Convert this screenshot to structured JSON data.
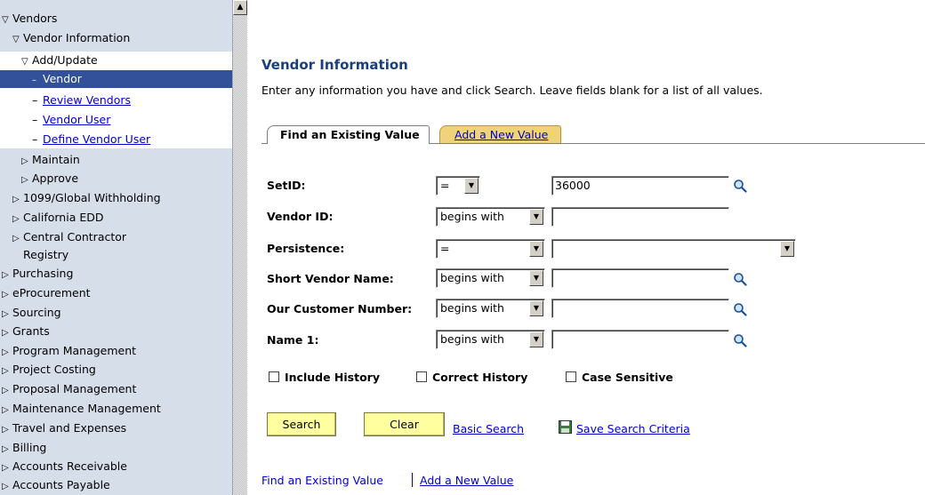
{
  "menu": {
    "items": [
      {
        "label": "Vendors",
        "marker": "▽",
        "indent": 0
      },
      {
        "label": "Vendor Information",
        "marker": "▽",
        "indent": 1
      },
      {
        "label": "Add/Update",
        "marker": "▽",
        "indent": 2
      },
      {
        "label": "Vendor",
        "marker": "–",
        "indent": 3
      },
      {
        "label": "Review Vendors",
        "marker": "–",
        "indent": 3
      },
      {
        "label": "Vendor User",
        "marker": "–",
        "indent": 3
      },
      {
        "label": "Define Vendor User",
        "marker": "–",
        "indent": 3
      },
      {
        "label": "Maintain",
        "marker": "▷",
        "indent": 2
      },
      {
        "label": "Approve",
        "marker": "▷",
        "indent": 2
      },
      {
        "label": "1099/Global Withholding",
        "marker": "▷",
        "indent": 1
      },
      {
        "label": "California EDD",
        "marker": "▷",
        "indent": 1
      },
      {
        "label": "Central Contractor",
        "marker": "▷",
        "indent": 1
      },
      {
        "label": "Registry",
        "marker": "",
        "indent": 1
      },
      {
        "label": "Purchasing",
        "marker": "▷",
        "indent": 0
      },
      {
        "label": "eProcurement",
        "marker": "▷",
        "indent": 0
      },
      {
        "label": "Sourcing",
        "marker": "▷",
        "indent": 0
      },
      {
        "label": "Grants",
        "marker": "▷",
        "indent": 0
      },
      {
        "label": "Program Management",
        "marker": "▷",
        "indent": 0
      },
      {
        "label": "Project Costing",
        "marker": "▷",
        "indent": 0
      },
      {
        "label": "Proposal Management",
        "marker": "▷",
        "indent": 0
      },
      {
        "label": "Maintenance Management",
        "marker": "▷",
        "indent": 0
      },
      {
        "label": "Travel and Expenses",
        "marker": "▷",
        "indent": 0
      },
      {
        "label": "Billing",
        "marker": "▷",
        "indent": 0
      },
      {
        "label": "Accounts Receivable",
        "marker": "▷",
        "indent": 0
      },
      {
        "label": "Accounts Payable",
        "marker": "▷",
        "indent": 0
      }
    ]
  },
  "page": {
    "title": "Vendor Information",
    "instructions": "Enter any information you have and click Search. Leave fields blank for a list of all values."
  },
  "tabs": {
    "active": "Find an Existing Value",
    "inactive": "Add a New Value"
  },
  "form": {
    "setid": {
      "label": "SetID:",
      "operator": "=",
      "value": "36000"
    },
    "vendor_id": {
      "label": "Vendor ID:",
      "operator": "begins with",
      "value": ""
    },
    "persistence": {
      "label": "Persistence:",
      "operator": "=",
      "value": ""
    },
    "short_vendor_name": {
      "label": "Short Vendor Name:",
      "operator": "begins with",
      "value": ""
    },
    "our_customer_number": {
      "label": "Our Customer Number:",
      "operator": "begins with",
      "value": ""
    },
    "name1": {
      "label": "Name 1:",
      "operator": "begins with",
      "value": ""
    }
  },
  "checkboxes": {
    "include_history": "Include History",
    "correct_history": "Correct History",
    "case_sensitive": "Case Sensitive"
  },
  "buttons": {
    "search": "Search",
    "clear": "Clear",
    "basic_search": "Basic Search",
    "save_search_criteria": "Save Search Criteria"
  },
  "footer": {
    "find_existing": "Find an Existing Value",
    "add_new": "Add a New Value"
  }
}
